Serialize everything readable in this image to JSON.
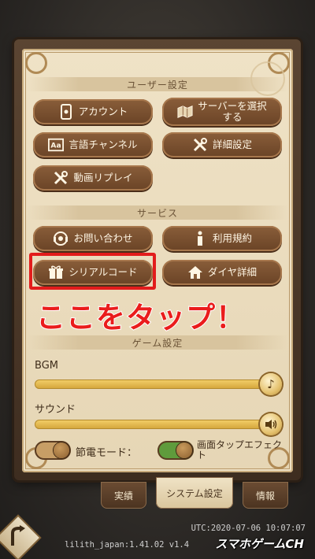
{
  "sections": {
    "user_settings": "ユーザー設定",
    "service": "サービス",
    "game_settings": "ゲーム設定"
  },
  "user_buttons": {
    "account": "アカウント",
    "server_select": "サーバーを選択する",
    "language_channel": "言語チャンネル",
    "detailed_settings": "詳細設定",
    "video_replay": "動画リプレイ"
  },
  "service_buttons": {
    "contact": "お問い合わせ",
    "terms": "利用規約",
    "serial_code": "シリアルコード",
    "diamond_details": "ダイヤ詳細"
  },
  "annotation": "ここをタップ！",
  "game_settings": {
    "bgm_label": "BGM",
    "bgm_level": 1.0,
    "sound_label": "サウンド",
    "sound_level": 1.0,
    "power_save_label": "節電モード：",
    "power_save_on": false,
    "tap_effect_label": "画面タップエフェクト",
    "tap_effect_on": true
  },
  "tabs": [
    "実績",
    "システム設定",
    "情報"
  ],
  "active_tab": "システム設定",
  "footer": {
    "utc": "UTC:2020-07-06 10:07:07",
    "version": "lilith_japan:1.41.02  v1.4",
    "watermark": "スマホゲームCH"
  },
  "colors": {
    "button": "#7a5130",
    "annotation": "#ea1c1c",
    "panel": "#ecdfc2"
  }
}
